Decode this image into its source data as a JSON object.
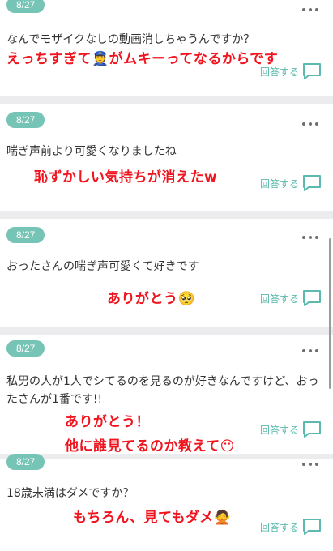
{
  "qa_items": [
    {
      "date": "8/27",
      "question": "なんでモザイクなしの動画消しちゃうんですか？",
      "answer_lines": [
        "えっちすぎて👮がムキーってなるからです"
      ],
      "reply_label": "回答する"
    },
    {
      "date": "8/27",
      "question": "喘ぎ声前より可愛くなりましたね",
      "answer_lines": [
        "恥ずかしい気持ちが消えたw"
      ],
      "reply_label": "回答する"
    },
    {
      "date": "8/27",
      "question": "おったさんの喘ぎ声可愛くて好きです",
      "answer_lines": [
        "ありがとう🥺"
      ],
      "reply_label": "回答する"
    },
    {
      "date": "8/27",
      "question": "私男の人が1人でシてるのを見るのが好きなんですけど、おったさんが1番です!!",
      "answer_lines": [
        "ありがとう！",
        "他に誰見てるのか教えて😶"
      ],
      "reply_label": "回答する"
    },
    {
      "date": "8/27",
      "question": "18歳未満はダメですか？",
      "answer_lines": [
        "もちろん、見てもダメ🙅"
      ],
      "reply_label": "回答する"
    }
  ],
  "icons": {
    "more": "more-horizontal-icon",
    "reply": "chat-bubble-icon"
  },
  "colors": {
    "accent": "#76c4b6",
    "answer": "#f0141e",
    "separator": "#ececee"
  }
}
